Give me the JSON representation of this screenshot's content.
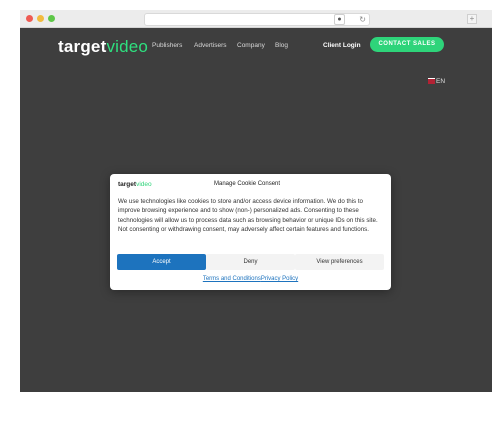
{
  "site": {
    "logo": {
      "part1": "target",
      "part2": "video"
    },
    "nav": [
      "Publishers",
      "Advertisers",
      "Company",
      "Blog"
    ],
    "client_login": "Client Login",
    "cta": "CONTACT SALES",
    "language": "EN"
  },
  "modal": {
    "logo": {
      "part1": "target",
      "part2": "video"
    },
    "title": "Manage Cookie Consent",
    "body": "We use technologies like cookies to store and/or access device information. We do this to improve browsing experience and to show (non-) personalized ads. Consenting to these technologies will allow us to process data such as browsing behavior or unique IDs on this site. Not consenting or withdrawing consent, may adversely affect certain features and functions.",
    "buttons": {
      "accept": "Accept",
      "deny": "Deny",
      "preferences": "View preferences"
    },
    "links": {
      "terms": "Terms and Conditions",
      "privacy": "Privacy Policy"
    }
  },
  "colors": {
    "accent": "#2ed47a",
    "primary_button": "#1d73be",
    "page_background": "#3e3e3e"
  }
}
